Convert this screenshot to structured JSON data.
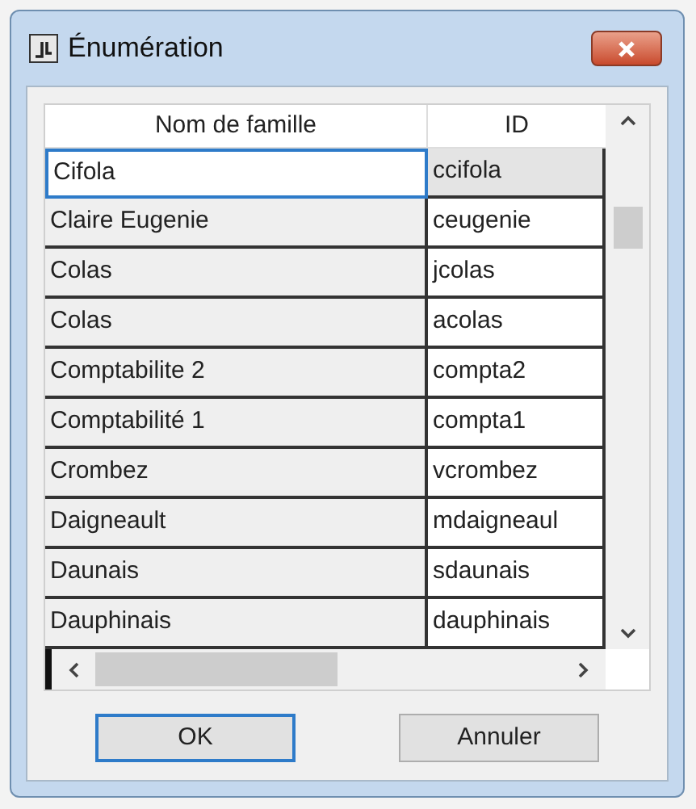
{
  "window": {
    "title": "Énumération"
  },
  "table": {
    "columns": [
      "Nom de famille",
      "ID"
    ],
    "rows": [
      {
        "name": "Cifola",
        "id": "ccifola",
        "selected": true
      },
      {
        "name": "Claire Eugenie",
        "id": "ceugenie",
        "selected": false
      },
      {
        "name": "Colas",
        "id": "jcolas",
        "selected": false
      },
      {
        "name": "Colas",
        "id": "acolas",
        "selected": false
      },
      {
        "name": "Comptabilite 2",
        "id": "compta2",
        "selected": false
      },
      {
        "name": "Comptabilité 1",
        "id": "compta1",
        "selected": false
      },
      {
        "name": "Crombez",
        "id": "vcrombez",
        "selected": false
      },
      {
        "name": "Daigneault",
        "id": "mdaigneaul",
        "selected": false
      },
      {
        "name": "Daunais",
        "id": "sdaunais",
        "selected": false
      },
      {
        "name": "Dauphinais",
        "id": "dauphinais",
        "selected": false
      }
    ]
  },
  "buttons": [
    {
      "label": "OK",
      "kind": "default"
    },
    {
      "label": "Annuler",
      "kind": "normal"
    }
  ]
}
